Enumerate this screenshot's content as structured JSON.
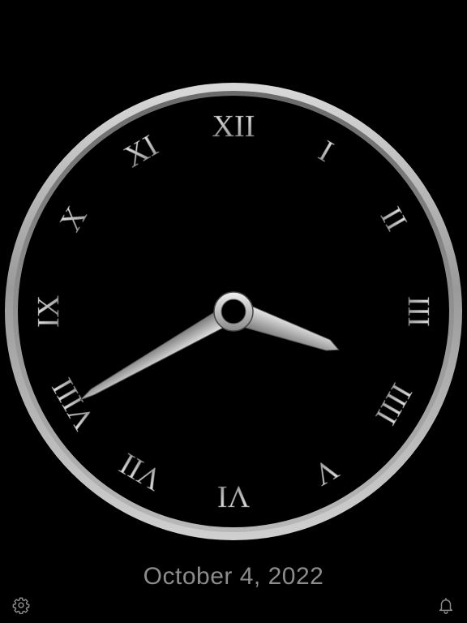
{
  "clock": {
    "numerals": [
      "XII",
      "I",
      "II",
      "III",
      "IIII",
      "V",
      "VI",
      "VII",
      "VIII",
      "IX",
      "X",
      "XI"
    ],
    "time": {
      "hour": 3,
      "minute": 40
    }
  },
  "date": {
    "text": "October 4, 2022"
  },
  "toolbar": {
    "settings_icon": "gear-icon",
    "alarm_icon": "bell-icon"
  },
  "colors": {
    "background": "#000000",
    "metal_light": "#e6e6e6",
    "metal_dark": "#6e6e6e",
    "date_text": "#8c8c8c"
  }
}
